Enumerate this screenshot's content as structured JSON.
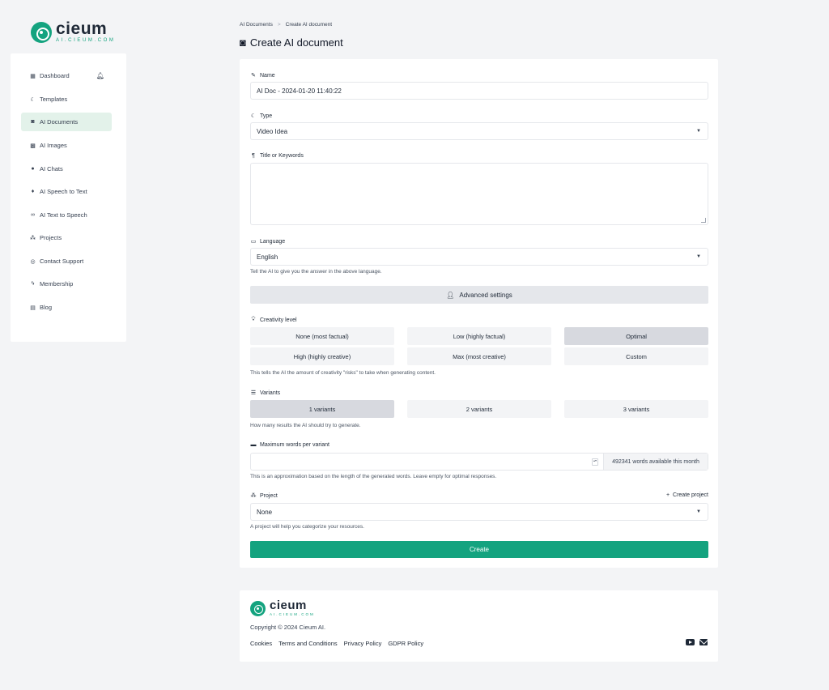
{
  "brand": {
    "name": "cieum",
    "domain": "AI.CIEUM.COM",
    "accent": "#14a37f"
  },
  "sidebar": {
    "items": [
      {
        "label": "Dashboard",
        "icon": "dashboard-icon"
      },
      {
        "label": "Templates",
        "icon": "moon-icon"
      },
      {
        "label": "AI Documents",
        "icon": "robot-icon",
        "active": true
      },
      {
        "label": "AI Images",
        "icon": "images-icon"
      },
      {
        "label": "AI Chats",
        "icon": "chats-icon"
      },
      {
        "label": "AI Speech to Text",
        "icon": "microphone-icon"
      },
      {
        "label": "AI Text to Speech",
        "icon": "voicemail-icon"
      },
      {
        "label": "Projects",
        "icon": "project-diagram-icon"
      },
      {
        "label": "Contact Support",
        "icon": "support-icon"
      },
      {
        "label": "Membership",
        "icon": "bolt-icon"
      },
      {
        "label": "Blog",
        "icon": "blog-icon"
      }
    ]
  },
  "breadcrumb": {
    "parent": "AI Documents",
    "separator": ">",
    "current": "Create AI document"
  },
  "page": {
    "title": "Create AI document"
  },
  "form": {
    "name": {
      "label": "Name",
      "value": "AI Doc - 2024-01-20 11:40:22"
    },
    "type": {
      "label": "Type",
      "value": "Video Idea"
    },
    "keywords": {
      "label": "Title or Keywords",
      "value": ""
    },
    "language": {
      "label": "Language",
      "value": "English",
      "help": "Tell the AI to give you the answer in the above language."
    },
    "advanced_label": "Advanced settings",
    "creativity": {
      "label": "Creativity level",
      "options": [
        "None (most factual)",
        "Low (highly factual)",
        "Optimal",
        "High (highly creative)",
        "Max (most creative)",
        "Custom"
      ],
      "selected": "Optimal",
      "help": "This tells the AI the amount of creativity \"risks\" to take when generating content."
    },
    "variants": {
      "label": "Variants",
      "options": [
        "1 variants",
        "2 variants",
        "3 variants"
      ],
      "selected": "1 variants",
      "help": "How many results the AI should try to generate."
    },
    "max_words": {
      "label": "Maximum words per variant",
      "value": "",
      "addon": "492341 words available this month",
      "help": "This is an approximation based on the length of the generated words. Leave empty for optimal responses."
    },
    "project": {
      "label": "Project",
      "create_label": "Create project",
      "value": "None",
      "help": "A project will help you categorize your resources."
    },
    "submit_label": "Create"
  },
  "footer": {
    "copyright": "Copyright © 2024 Cieum AI.",
    "links": [
      "Cookies",
      "Terms and Conditions",
      "Privacy Policy",
      "GDPR Policy"
    ]
  }
}
